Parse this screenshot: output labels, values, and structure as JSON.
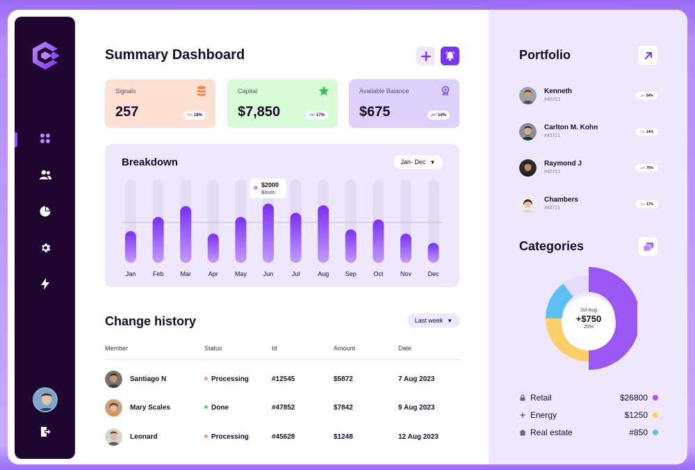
{
  "header": {
    "title": "Summary Dashboard",
    "add_icon": "plus-icon",
    "bell_icon": "bell-icon"
  },
  "sidebar": {
    "items": [
      {
        "name": "dashboard",
        "icon": "grid-icon",
        "active": true
      },
      {
        "name": "users",
        "icon": "users-icon"
      },
      {
        "name": "reports",
        "icon": "pie-chart-icon"
      },
      {
        "name": "settings",
        "icon": "gear-icon"
      },
      {
        "name": "activity",
        "icon": "bolt-icon"
      }
    ],
    "logout_icon": "logout-icon"
  },
  "stats": [
    {
      "label": "Signals",
      "value": "257",
      "change": "18%",
      "color": "#fde0d2",
      "icon": "database-icon"
    },
    {
      "label": "Capital",
      "value": "$7,850",
      "change": "17%",
      "color": "#d6fbd6",
      "icon": "star-icon"
    },
    {
      "label": "Available Balance",
      "value": "$675",
      "change": "14%",
      "color": "#ddd0fb",
      "icon": "badge-icon"
    }
  ],
  "breakdown": {
    "title": "Breakdown",
    "range": "Jan- Dec",
    "tooltip": {
      "value": "$2000",
      "label": "Bonds"
    }
  },
  "chart_data": {
    "type": "bar",
    "categories": [
      "Jan",
      "Feb",
      "Mar",
      "Apr",
      "May",
      "Jun",
      "Jul",
      "Aug",
      "Sep",
      "Oct",
      "Nov",
      "Dec"
    ],
    "values": [
      38,
      55,
      68,
      35,
      55,
      71,
      60,
      69,
      40,
      52,
      35,
      24
    ],
    "ylim": [
      0,
      100
    ],
    "highlighted": "Jun",
    "grid": false
  },
  "history": {
    "title": "Change history",
    "range": "Last week",
    "columns": [
      "Member",
      "Status",
      "Id",
      "Amount",
      "Date"
    ],
    "rows": [
      {
        "member": "Santiago N",
        "status": "Processing",
        "status_color": "#f59a6b",
        "id": "#12545",
        "amount": "$5872",
        "date": "7 Aug 2023"
      },
      {
        "member": "Mary Scales",
        "status": "Done",
        "status_color": "#55d66b",
        "id": "#47852",
        "amount": "$7842",
        "date": "9 Aug 2023"
      },
      {
        "member": "Leonard",
        "status": "Processing",
        "status_color": "#f59a6b",
        "id": "#45628",
        "amount": "$1248",
        "date": "12 Aug 2023"
      }
    ]
  },
  "portfolio": {
    "title": "Portfolio",
    "open_icon": "arrow-up-right-icon",
    "items": [
      {
        "name": "Kenneth",
        "id": "#45721",
        "change": "54%"
      },
      {
        "name": "Carlton M. Kohn",
        "id": "#45721",
        "change": "14%"
      },
      {
        "name": "Raymond J",
        "id": "#45721",
        "change": "75%"
      },
      {
        "name": "Chambers",
        "id": "#45721",
        "change": "17%"
      }
    ]
  },
  "categories": {
    "title": "Categories",
    "icon": "stack-icon",
    "center": {
      "period": "Jul-Aug",
      "value": "+$750",
      "percent": "25%"
    },
    "slices": [
      {
        "value": 50,
        "color": "#9b57f3"
      },
      {
        "value": 25,
        "color": "#ffd06a"
      },
      {
        "value": 15,
        "color": "#5cc0f5"
      },
      {
        "value": 10,
        "color": "#e4dcfa"
      }
    ],
    "legend": [
      {
        "label": "Retail",
        "value": "$26800",
        "color": "#a158f4",
        "icon": "lock-icon"
      },
      {
        "label": "Energy",
        "value": "$1250",
        "color": "#ffd34a",
        "icon": "spark-icon"
      },
      {
        "label": "Real estate",
        "value": "#850",
        "color": "#5cc0f5",
        "icon": "home-icon"
      }
    ]
  }
}
